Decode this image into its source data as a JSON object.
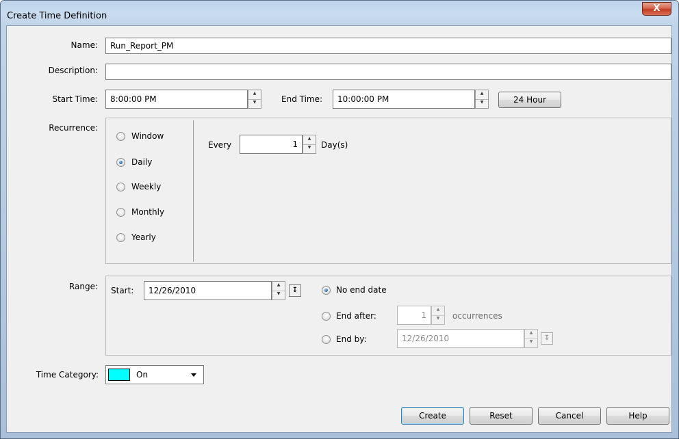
{
  "window": {
    "title": "Create Time Definition",
    "close_glyph": "X"
  },
  "form": {
    "name_label": "Name:",
    "name_value": "Run_Report_PM",
    "description_label": "Description:",
    "description_value": "",
    "start_time_label": "Start Time:",
    "start_time_value": "8:00:00 PM",
    "end_time_label": "End Time:",
    "end_time_value": "10:00:00 PM",
    "hour_button_label": "24 Hour"
  },
  "recurrence": {
    "label": "Recurrence:",
    "options": [
      {
        "label": "Window",
        "checked": false
      },
      {
        "label": "Daily",
        "checked": true
      },
      {
        "label": "Weekly",
        "checked": false
      },
      {
        "label": "Monthly",
        "checked": false
      },
      {
        "label": "Yearly",
        "checked": false
      }
    ],
    "every_label": "Every",
    "every_value": "1",
    "unit_label": "Day(s)"
  },
  "range": {
    "label": "Range:",
    "start_label": "Start:",
    "start_value": "12/26/2010",
    "no_end_label": "No end date",
    "end_after_label": "End after:",
    "end_after_value": "1",
    "occurrences_label": "occurrences",
    "end_by_label": "End by:",
    "end_by_value": "12/26/2010",
    "selected": "No end date"
  },
  "time_category": {
    "label": "Time Category:",
    "value": "On",
    "swatch_color": "#00ffff"
  },
  "buttons": {
    "create": "Create",
    "reset": "Reset",
    "cancel": "Cancel",
    "help": "Help"
  }
}
